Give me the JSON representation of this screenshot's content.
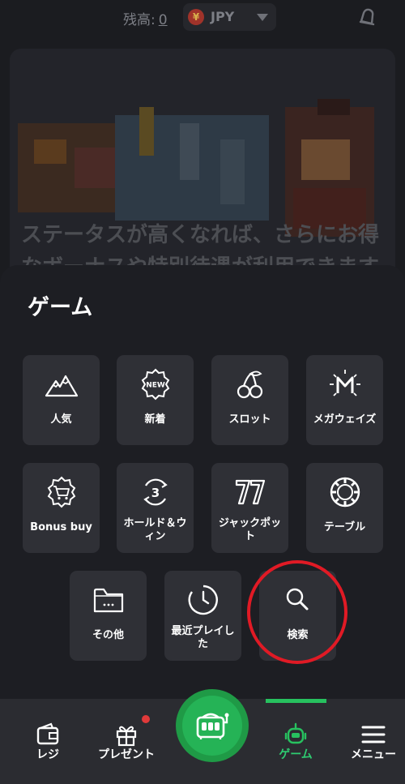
{
  "header": {
    "balance_label": "残高:",
    "balance_value": "0",
    "currency_symbol": "¥",
    "currency_code": "JPY"
  },
  "banner": {
    "text_line1": "ステータスが高くなれば、さらにお得",
    "text_line2": "なボーナスや特別待遇が利用できます"
  },
  "sheet": {
    "title": "ゲーム",
    "categories": [
      {
        "label": "人気",
        "icon": "mountain-icon"
      },
      {
        "label": "新着",
        "icon": "new-badge-icon"
      },
      {
        "label": "スロット",
        "icon": "cherries-icon"
      },
      {
        "label": "メガウェイズ",
        "icon": "megaways-icon"
      },
      {
        "label": "Bonus buy",
        "icon": "shopping-cart-icon"
      },
      {
        "label": "ホールド＆ウィン",
        "icon": "hold-and-win-icon"
      },
      {
        "label": "ジャックポット",
        "icon": "double-seven-icon"
      },
      {
        "label": "テーブル",
        "icon": "poker-chip-icon"
      },
      {
        "label": "その他",
        "icon": "folder-icon"
      },
      {
        "label": "最近プレイした",
        "icon": "clock-icon"
      },
      {
        "label": "検索",
        "icon": "search-icon"
      }
    ]
  },
  "nav": {
    "items": [
      {
        "label": "レジ",
        "icon": "wallet-icon"
      },
      {
        "label": "プレゼント",
        "icon": "gift-icon"
      },
      {
        "label": "ゲーム",
        "icon": "robot-icon"
      },
      {
        "label": "メニュー",
        "icon": "hamburger-menu-icon"
      }
    ],
    "play_icon": "slot-machine-icon"
  },
  "colors": {
    "accent_green": "#27c15f",
    "highlight_red": "#e01a25",
    "tile_bg": "#2f3036",
    "sheet_bg": "#1d1e23"
  }
}
